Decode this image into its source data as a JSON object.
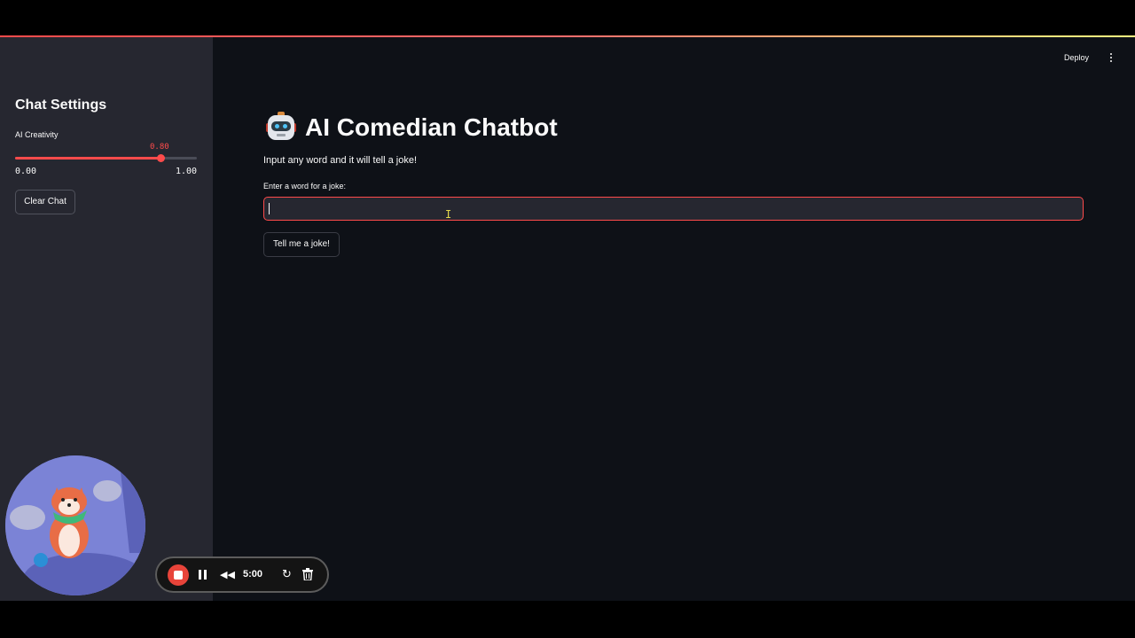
{
  "sidebar": {
    "title": "Chat Settings",
    "slider": {
      "label": "AI Creativity",
      "value": "0.80",
      "value_fraction": 0.8,
      "min": "0.00",
      "max": "1.00"
    },
    "clear_button_label": "Clear Chat"
  },
  "header": {
    "deploy_label": "Deploy",
    "menu_icon": "kebab-menu-icon"
  },
  "main": {
    "title_icon": "robot-icon",
    "title": "AI Comedian Chatbot",
    "subtitle": "Input any word and it will tell a joke!",
    "input_label": "Enter a word for a joke:",
    "input_value": "",
    "submit_label": "Tell me a joke!"
  },
  "recorder": {
    "time": "5:00",
    "icons": [
      "stop-icon",
      "pause-icon",
      "rewind-icon",
      "restart-icon",
      "trash-icon"
    ]
  },
  "colors": {
    "accent": "#ff4b4b",
    "sidebar_bg": "#262730",
    "main_bg": "#0e1117",
    "text": "#fafafa"
  }
}
